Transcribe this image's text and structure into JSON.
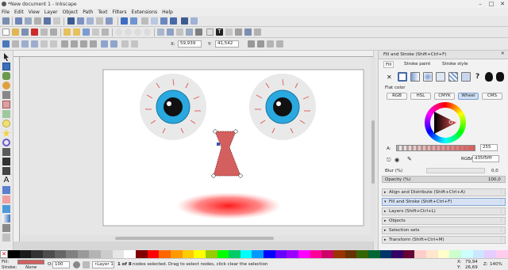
{
  "window": {
    "title": "*New document 1 - Inkscape",
    "minimize": "–",
    "maximize": "□",
    "close": "✕"
  },
  "menu": [
    "File",
    "Edit",
    "View",
    "Layer",
    "Object",
    "Path",
    "Text",
    "Filters",
    "Extensions",
    "Help"
  ],
  "tool_controls": {
    "x_label": "X:",
    "x_value": "59,939",
    "y_label": "Y:",
    "y_value": "41,542"
  },
  "dock": {
    "title": "Fill and Stroke (Shift+Ctrl+F)",
    "tabs": [
      "Fill",
      "Stroke paint",
      "Stroke style"
    ],
    "flat_color_label": "Flat color",
    "mode_buttons": [
      "RGB",
      "HSL",
      "CMYK",
      "Wheel",
      "CMS"
    ],
    "active_mode": "Wheel",
    "alpha_label": "A:",
    "alpha_value": "255",
    "rgba_label": "RGBA:",
    "rgba_value": "d35f5fff",
    "blur_label": "Blur (%)",
    "blur_value": "0,0",
    "opacity_label": "Opacity (%)",
    "opacity_value": "100,0",
    "panels": [
      "Align and Distribute (Shift+Ctrl+A)",
      "Fill and Stroke (Shift+Ctrl+F)",
      "Layers (Shift+Ctrl+L)",
      "Objects",
      "Selection sets",
      "Transform (Shift+Ctrl+M)"
    ],
    "fill_color": "#d35f5f"
  },
  "status": {
    "fill_label": "Fill:",
    "stroke_label": "Stroke:",
    "stroke_value": "None",
    "opacity_label": "O:",
    "opacity_value": "100",
    "layer": "•Layer 1",
    "message_bold": "1 of 8",
    "message": " nodes selected. Drag to select nodes, click clear the selection",
    "x_label": "X:",
    "x_value": "79,94",
    "y_label": "Y:",
    "y_value": "26,69",
    "z_label": "Z:",
    "z_value": "140%"
  },
  "palette_colors": [
    "#000000",
    "#1a1a1a",
    "#333333",
    "#4d4d4d",
    "#666666",
    "#808080",
    "#999999",
    "#b3b3b3",
    "#cccccc",
    "#e6e6e6",
    "#ffffff",
    "#800000",
    "#ff0000",
    "#ff6600",
    "#ff9900",
    "#ffcc00",
    "#ffff00",
    "#99cc00",
    "#00ff00",
    "#00cc66",
    "#00ffff",
    "#0099ff",
    "#0000ff",
    "#6600ff",
    "#9900ff",
    "#ff00ff",
    "#ff0099",
    "#cc0066",
    "#993300",
    "#663300",
    "#336600",
    "#006633",
    "#003366",
    "#330066",
    "#660033",
    "#ffcccc",
    "#ffe6cc",
    "#ffffcc",
    "#ccffcc",
    "#ccffff",
    "#cce6ff",
    "#e6ccff",
    "#ffccee"
  ]
}
